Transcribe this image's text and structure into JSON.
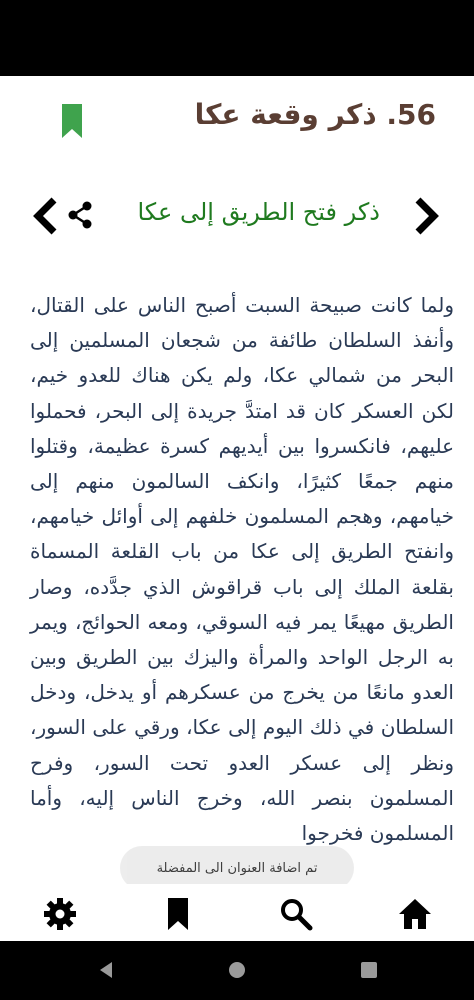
{
  "header": {
    "chapter_title": "56. ذكر وقعة عكا"
  },
  "section": {
    "title": "ذكر فتح الطريق إلى عكا"
  },
  "content": {
    "text": "ولما كانت صبيحة السبت أصبح الناس على القتال، وأنفذ السلطان طائفة من شجعان المسلمين إلى البحر من شمالي عكا، ولم يكن هناك للعدو خيم، لكن العسكر كان قد امتدَّ جريدة إلى البحر، فحملوا عليهم، فانكسروا بين أيديهم كسرة عظيمة، وقتلوا منهم جمعًا كثيرًا، وانكف السالمون منهم إلى خيامهم، وهجم المسلمون خلفهم إلى أوائل خيامهم، وانفتح الطريق إلى عكا من باب القلعة المسماة بقلعة الملك إلى باب قراقوش الذي جدَّده، وصار الطريق مهيعًا يمر فيه السوقي، ومعه الحوائج، ويمر به الرجل الواحد والمرأة واليزك بين الطريق وبين العدو مانعًا من يخرج من عسكرهم أو يدخل، ودخل السلطان في ذلك اليوم إلى عكا، ورقي على السور، ونظر إلى عسكر العدو تحت السور، وفرح المسلمون بنصر الله، وخرج الناس إليه، وأما المسلمون فخرجوا"
  },
  "toast": {
    "message": "تم اضافة العنوان الى المفضلة"
  },
  "colors": {
    "title": "#5a3e33",
    "section": "#1f7a1f",
    "bookmark": "#3fa34d",
    "body_text": "#2a3a55"
  },
  "icons": {
    "top": [
      "bookmark-icon"
    ],
    "section_row": [
      "chevron-left-icon",
      "share-icon",
      "chevron-right-icon"
    ],
    "bottom_nav": [
      "gear-icon",
      "bookmark-icon",
      "search-icon",
      "home-icon"
    ],
    "system_nav": [
      "back-icon",
      "home-circle-icon",
      "recents-icon"
    ]
  }
}
